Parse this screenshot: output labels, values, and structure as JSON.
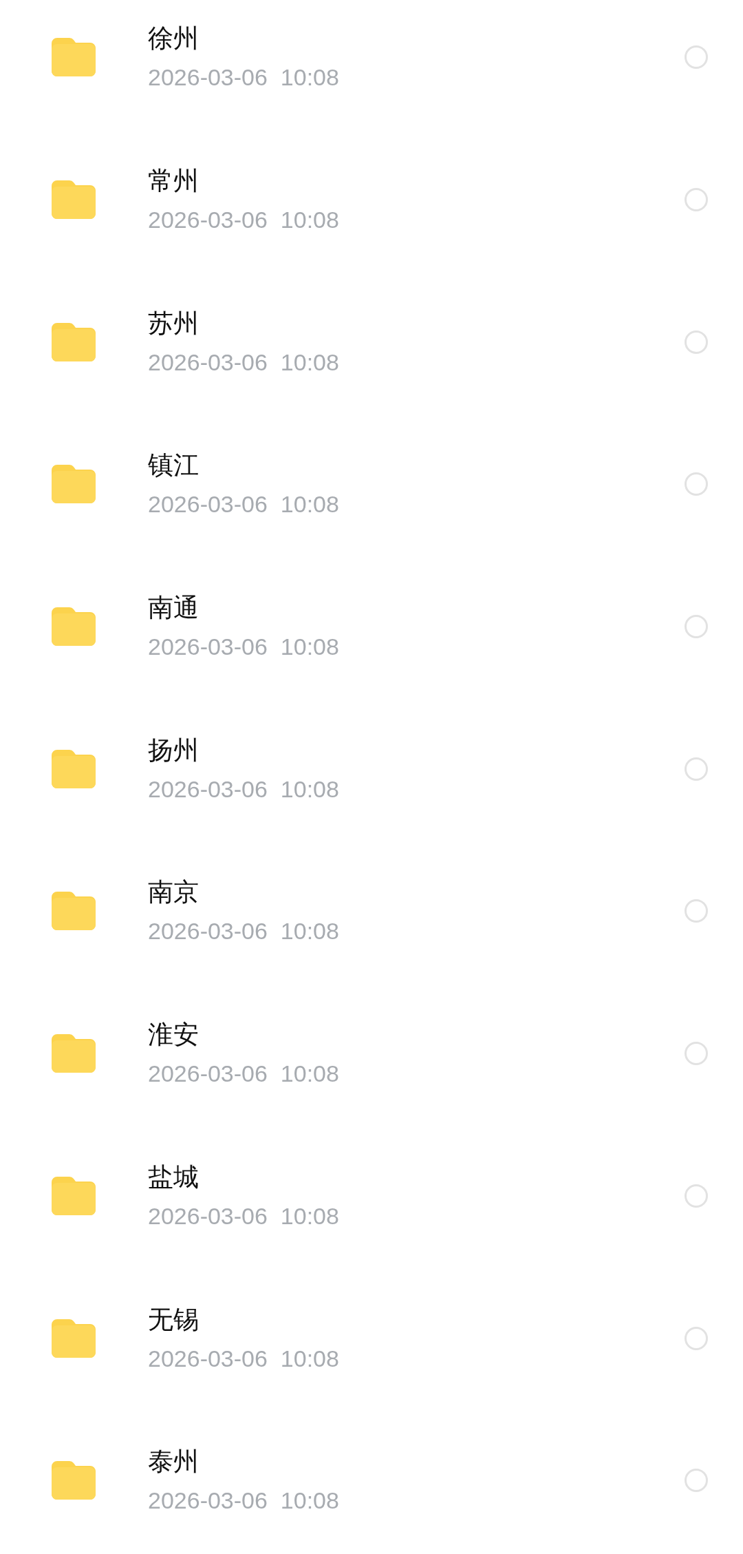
{
  "files": [
    {
      "name": "徐州",
      "modified": "2026-03-06  10:08",
      "selected": false
    },
    {
      "name": "常州",
      "modified": "2026-03-06  10:08",
      "selected": false
    },
    {
      "name": "苏州",
      "modified": "2026-03-06  10:08",
      "selected": false
    },
    {
      "name": "镇江",
      "modified": "2026-03-06  10:08",
      "selected": false
    },
    {
      "name": "南通",
      "modified": "2026-03-06  10:08",
      "selected": false
    },
    {
      "name": "扬州",
      "modified": "2026-03-06  10:08",
      "selected": false
    },
    {
      "name": "南京",
      "modified": "2026-03-06  10:08",
      "selected": false
    },
    {
      "name": "淮安",
      "modified": "2026-03-06  10:08",
      "selected": false
    },
    {
      "name": "盐城",
      "modified": "2026-03-06  10:08",
      "selected": false
    },
    {
      "name": "无锡",
      "modified": "2026-03-06  10:08",
      "selected": false
    },
    {
      "name": "泰州",
      "modified": "2026-03-06  10:08",
      "selected": false
    }
  ]
}
